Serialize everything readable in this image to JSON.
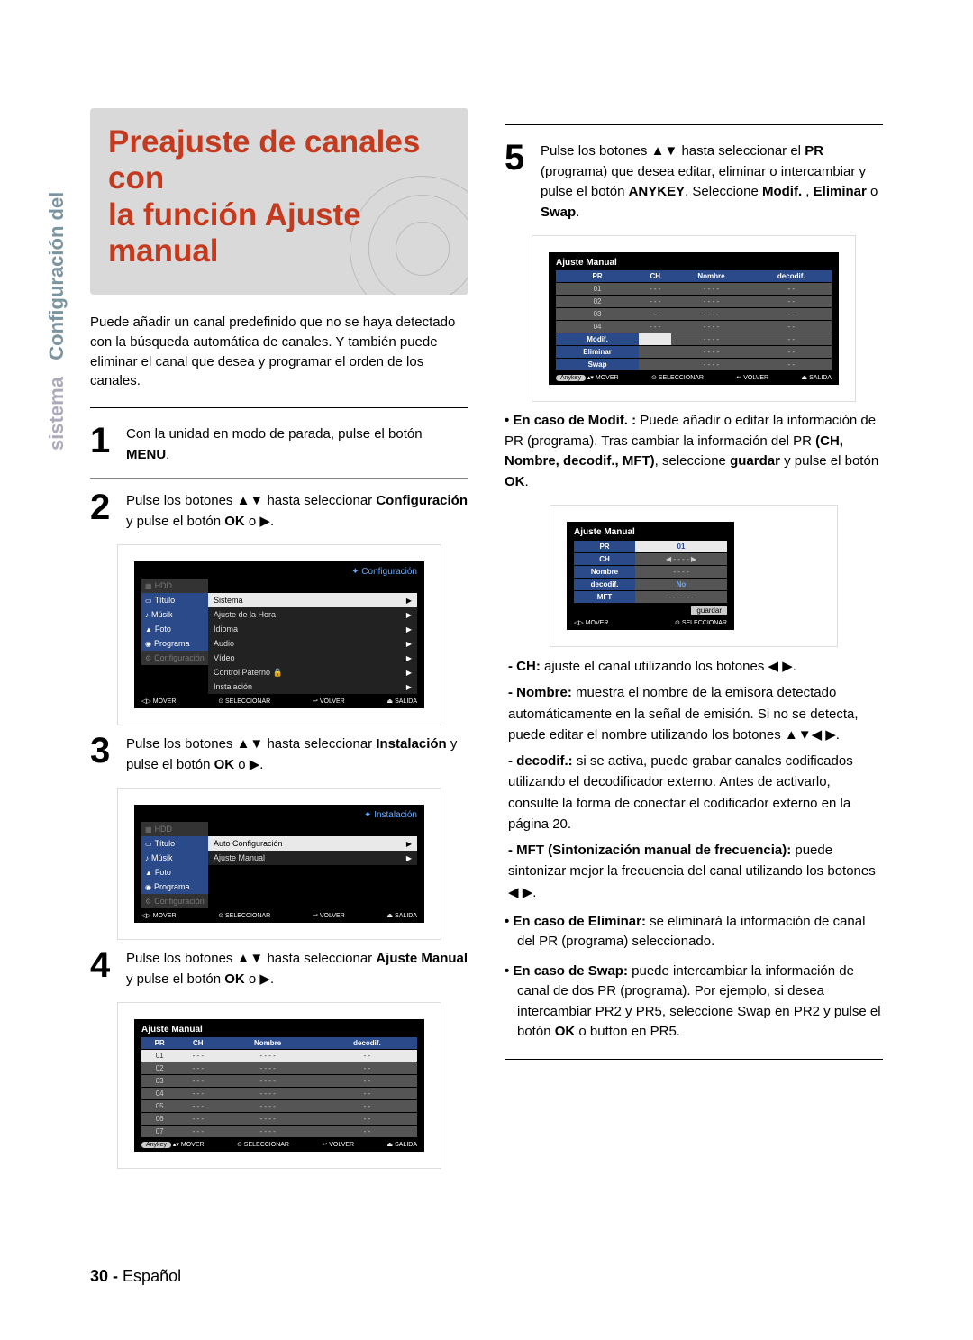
{
  "sidetab": {
    "main": "Configuración del",
    "sub": "sistema"
  },
  "hero": {
    "title_l1": "Preajuste de canales con",
    "title_l2": "la función Ajuste manual"
  },
  "intro": "Puede añadir un canal predefinido que no se haya detectado con la búsqueda automática de canales. Y también puede eliminar el canal que desea y programar el orden de los canales.",
  "steps": {
    "s1": {
      "num": "1",
      "pre": "Con la unidad en modo de parada, pulse el botón ",
      "b1": "MENU",
      "post": "."
    },
    "s2": {
      "num": "2",
      "pre": "Pulse los botones ▲▼ hasta seleccionar ",
      "b1": "Configuración",
      "mid": " y pulse el botón ",
      "b2": "OK",
      "post": " o ▶."
    },
    "s3": {
      "num": "3",
      "pre": "Pulse los botones ▲▼ hasta seleccionar ",
      "b1": "Instalación",
      "mid": " y pulse el botón ",
      "b2": "OK",
      "post": " o ▶."
    },
    "s4": {
      "num": "4",
      "pre": "Pulse los botones ▲▼ hasta seleccionar ",
      "b1": "Ajuste Manual",
      "mid": " y pulse el botón ",
      "b2": "OK",
      "post": " o ▶."
    },
    "s5": {
      "num": "5",
      "pre": "Pulse los botones ▲▼ hasta seleccionar el ",
      "b1": "PR",
      "mid1": " (programa) que desea editar, eliminar o intercambiar y pulse el botón ",
      "b2": "ANYKEY",
      "mid2": ". Seleccione ",
      "b3": "Modif.",
      "comma": " , ",
      "b4": "Eliminar",
      "or": " o ",
      "b5": "Swap",
      "post": "."
    }
  },
  "osd1": {
    "header": "✦   Configuración",
    "hdd": "HDD",
    "side": [
      "Título",
      "Músik",
      "Foto",
      "Programa",
      "Configuración"
    ],
    "items": [
      "Sistema",
      "Ajuste de la Hora",
      "Idioma",
      "Audio",
      "Vídeo",
      "Control Paterno 🔒",
      "Instalación"
    ],
    "foot": {
      "mover": "MOVER",
      "sel": "SELECCIONAR",
      "volver": "VOLVER",
      "salida": "SALIDA"
    }
  },
  "osd2": {
    "header": "✦   Instalación",
    "items": [
      "Auto Configuración",
      "Ajuste Manual"
    ]
  },
  "osd3": {
    "title": "Ajuste Manual",
    "cols": [
      "PR",
      "CH",
      "Nombre",
      "decodif."
    ],
    "rows": [
      [
        "01",
        "- - -",
        "- - - -",
        "- -"
      ],
      [
        "02",
        "- - -",
        "- - - -",
        "- -"
      ],
      [
        "03",
        "- - -",
        "- - - -",
        "- -"
      ],
      [
        "04",
        "- - -",
        "- - - -",
        "- -"
      ],
      [
        "05",
        "- - -",
        "- - - -",
        "- -"
      ],
      [
        "06",
        "- - -",
        "- - - -",
        "- -"
      ],
      [
        "07",
        "- - -",
        "- - - -",
        "- -"
      ]
    ],
    "anykey": "Anykey"
  },
  "osd4": {
    "title": "Ajuste Manual",
    "cols": [
      "PR",
      "CH",
      "Nombre",
      "decodif."
    ],
    "rows": [
      [
        "01",
        "- - -",
        "- - - -",
        "- -"
      ],
      [
        "02",
        "- - -",
        "- - - -",
        "- -"
      ],
      [
        "03",
        "- - -",
        "- - - -",
        "- -"
      ],
      [
        "04",
        "- - -",
        "- - - -",
        "- -"
      ]
    ],
    "context": [
      "Modif.",
      "Eliminar",
      "Swap"
    ]
  },
  "osd5": {
    "title": "Ajuste Manual",
    "rows": [
      {
        "l": "PR",
        "v": "01"
      },
      {
        "l": "CH",
        "v": "◀   - - - -   ▶"
      },
      {
        "l": "Nombre",
        "v": "- - - -"
      },
      {
        "l": "decodif.",
        "v": "No"
      },
      {
        "l": "MFT",
        "v": "- - -   - - -"
      }
    ],
    "save": "guardar",
    "foot": {
      "mover": "MOVER",
      "sel": "SELECCIONAR"
    }
  },
  "modif_block": {
    "lead_b": "• En caso de Modif. : ",
    "lead": "Puede añadir o editar la información de PR (programa). Tras cambiar la información del PR ",
    "b_fields": "(CH, Nombre, decodif., MFT)",
    "mid": ", seleccione ",
    "b_g": "guardar",
    "mid2": " y pulse el botón ",
    "b_ok": "OK",
    "post": "."
  },
  "details": {
    "ch": {
      "b": "- CH:",
      "t": " ajuste el canal utilizando los botones ◀ ▶."
    },
    "nombre": {
      "b": "- Nombre:",
      "t": " muestra el nombre de la emisora detectado automáticamente en la señal de emisión. Si no se detecta, puede editar el nombre utilizando los botones ▲▼◀ ▶."
    },
    "decodif": {
      "b": "- decodif.:",
      "t": " si se activa, puede grabar canales codificados utilizando el decodificador externo. Antes de activarlo, consulte la forma de conectar el codificador externo en la página 20."
    },
    "mft": {
      "b": "- MFT (Sintonización manual de frecuencia):",
      "t": " puede sintonizar mejor la frecuencia del canal utilizando los botones ◀ ▶."
    }
  },
  "elim": {
    "b": "• En caso de Eliminar:",
    "t": " se eliminará la información de canal del PR (programa) seleccionado."
  },
  "swap": {
    "b": "• En caso de Swap:",
    "t": " puede intercambiar la información de canal de dos PR (programa). Por ejemplo, si desea intercambiar PR2 y PR5, seleccione Swap en PR2 y pulse el botón ",
    "b2": "OK",
    "t2": " o button en PR5."
  },
  "footer": {
    "page": "30 -",
    "lang": "Español"
  }
}
